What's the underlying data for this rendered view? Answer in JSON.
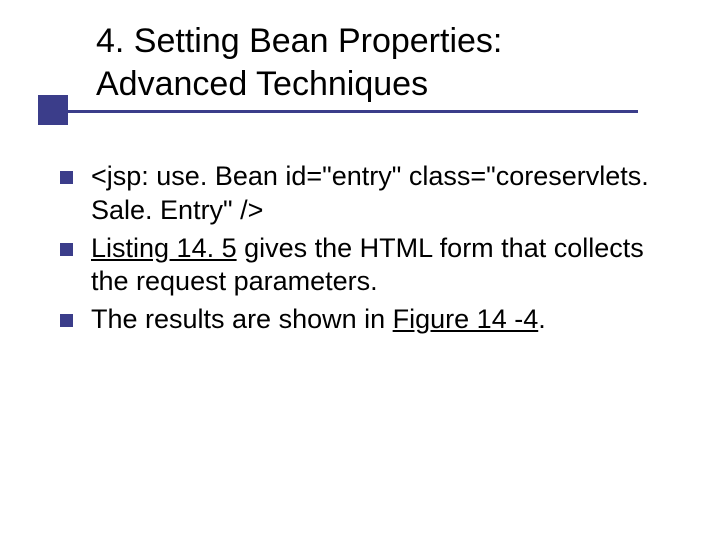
{
  "title": {
    "line1": "4. Setting Bean Properties:",
    "line2": "Advanced Techniques"
  },
  "bullets": [
    {
      "pre": "<jsp: use. Bean id=\"entry\" class=\"coreservlets. Sale. Entry\" />",
      "link": "",
      "post": ""
    },
    {
      "pre": "",
      "link": "Listing 14. 5",
      "post": " gives the HTML form that collects the request parameters."
    },
    {
      "pre": "The results are shown in ",
      "link": "Figure 14 -4",
      "post": "."
    }
  ],
  "colors": {
    "accent": "#3b3d8a"
  }
}
